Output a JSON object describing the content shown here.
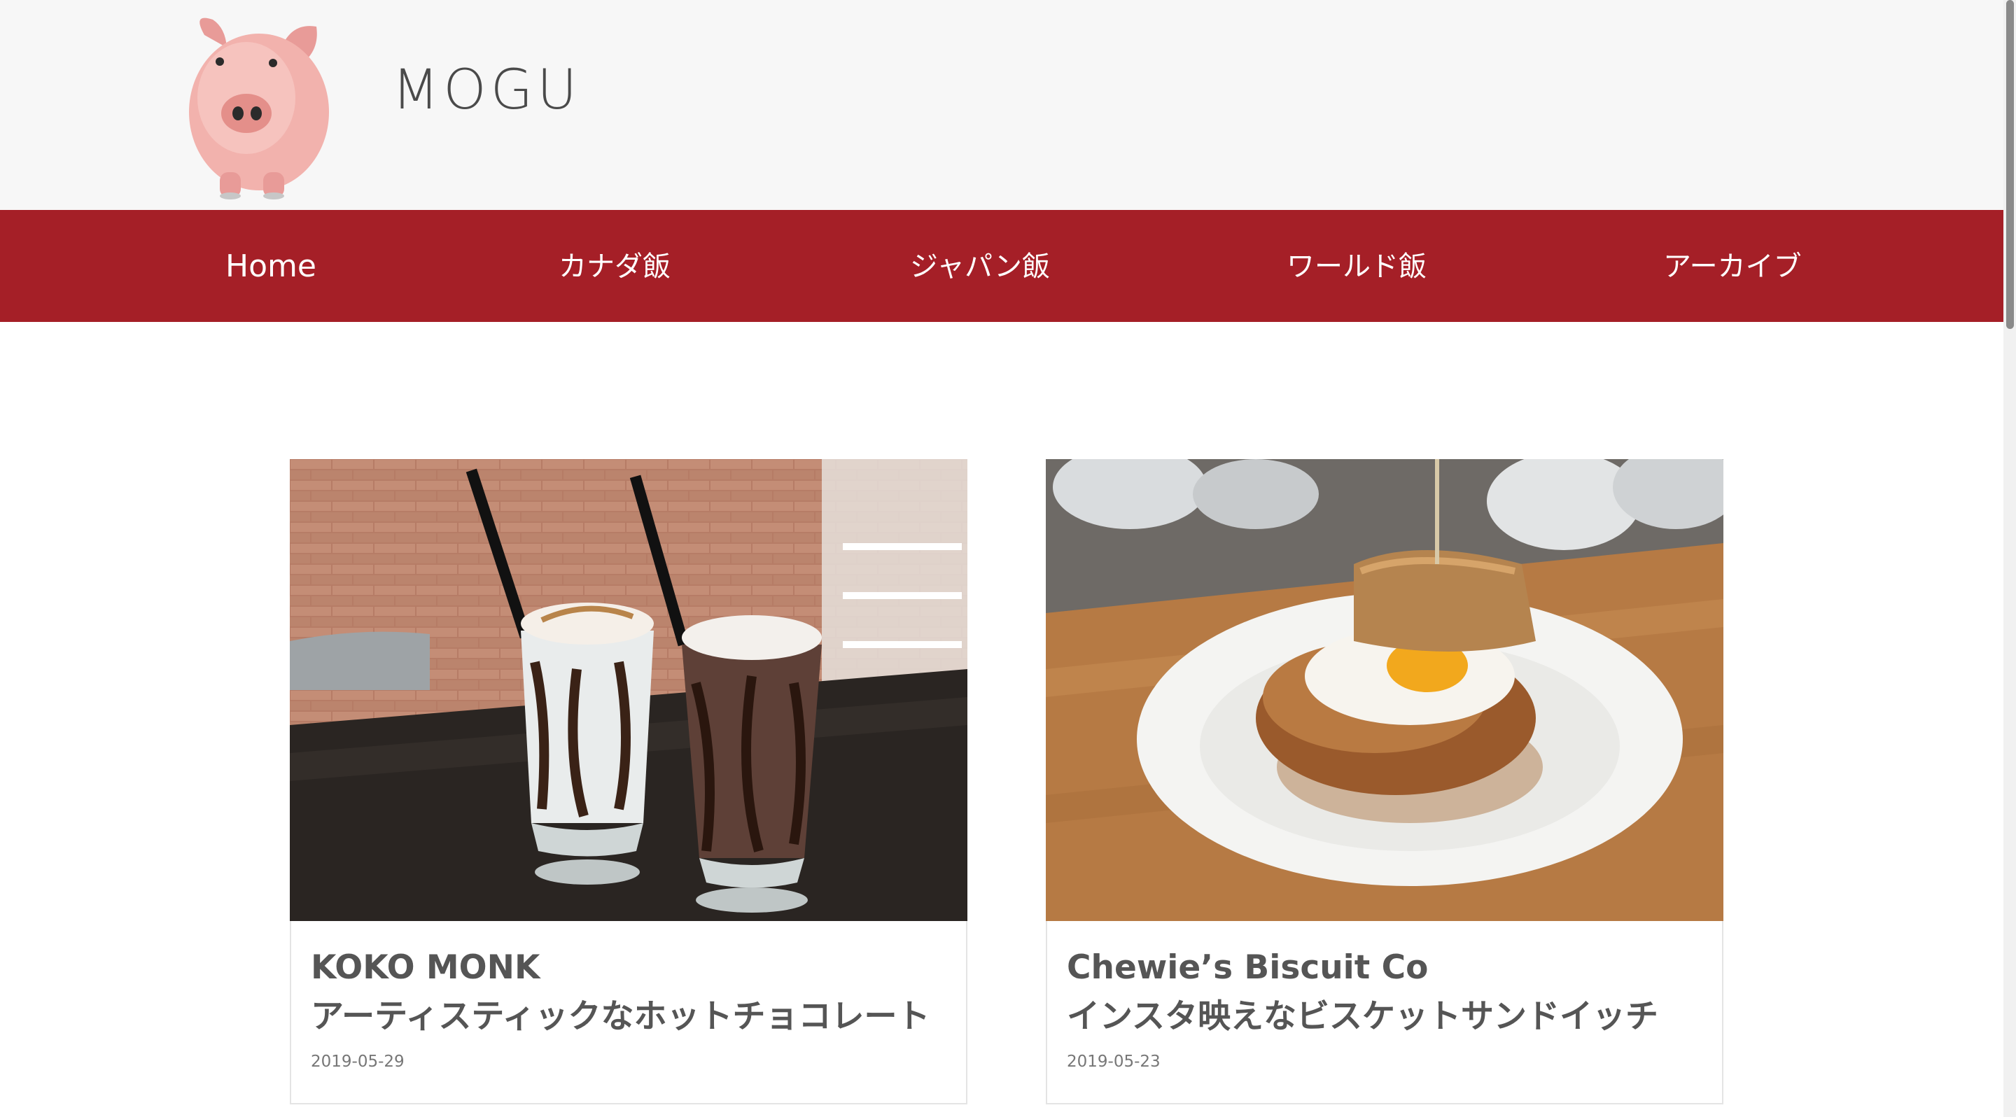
{
  "site": {
    "title": "MOGU",
    "logo_icon": "piggy-bank-icon"
  },
  "nav": {
    "items": [
      {
        "label": "Home"
      },
      {
        "label": "カナダ飯"
      },
      {
        "label": "ジャパン飯"
      },
      {
        "label": "ワールド飯"
      },
      {
        "label": "アーカイブ"
      }
    ]
  },
  "posts": [
    {
      "title_line1": "KOKO MONK",
      "title_line2": "アーティスティックなホットチョコレート",
      "date": "2019-05-29",
      "image_icon": "hot-chocolate-photo"
    },
    {
      "title_line1": "Chewie’s Biscuit Co",
      "title_line2": "インスタ映えなビスケットサンドイッチ",
      "date": "2019-05-23",
      "image_icon": "biscuit-sandwich-photo"
    }
  ],
  "colors": {
    "nav_background": "#a51f27",
    "header_background": "#f7f7f7",
    "title_text": "#555555"
  }
}
